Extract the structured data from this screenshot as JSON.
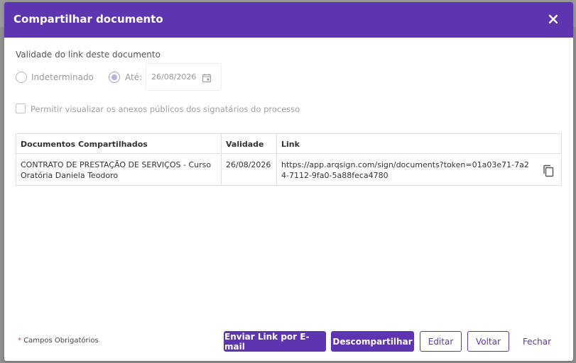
{
  "modal": {
    "title": "Compartilhar documento",
    "validity_label": "Validade do link deste documento",
    "radio_indeterminate_label": "Indeterminado",
    "radio_until_label": "Até:",
    "date_value": "26/08/2026",
    "checkbox_label": "Permitir visualizar os anexos públicos dos signatários do processo",
    "table": {
      "headers": [
        "Documentos Compartilhados",
        "Validade",
        "Link"
      ],
      "rows": [
        {
          "document": "CONTRATO DE PRESTAÇÃO DE SERVIÇOS - Curso Oratória Daniela Teodoro",
          "validity": "26/08/2026",
          "link": "https://app.arqsign.com/sign/documents?token=01a03e71-7a24-7112-9fa0-5a88feca4780"
        }
      ]
    },
    "required_star": "*",
    "required_note": "Campos Obrigatórios",
    "buttons": {
      "send_email": "Enviar Link por E-mail",
      "unshare": "Descompartilhar",
      "edit": "Editar",
      "back": "Voltar",
      "close": "Fechar"
    }
  },
  "colors": {
    "primary": "#5e35b1",
    "required_star": "#e53935"
  },
  "icons": [
    "close-icon",
    "calendar-icon",
    "copy-icon"
  ]
}
